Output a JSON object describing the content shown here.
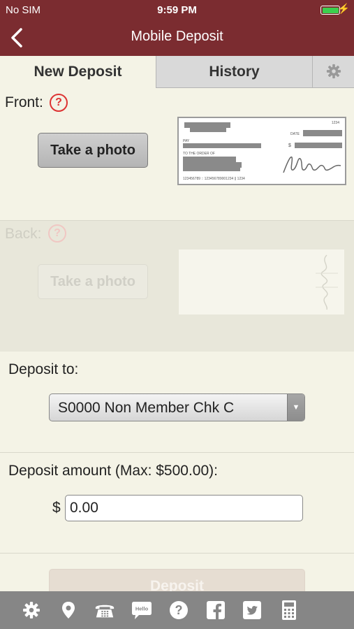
{
  "status_bar": {
    "carrier": "No SIM",
    "time": "9:59 PM"
  },
  "nav": {
    "title": "Mobile Deposit"
  },
  "tabs": {
    "new_deposit": "New Deposit",
    "history": "History"
  },
  "front": {
    "label": "Front:",
    "help": "?",
    "button": "Take a photo"
  },
  "back": {
    "label": "Back:",
    "help": "?",
    "button": "Take a photo"
  },
  "check_sample": {
    "number": "1234",
    "date_label": "DATE",
    "pay_label": "PAY",
    "order_label": "TO THE ORDER OF",
    "dollar_sign": "$",
    "micr": "123456789 :: 123456789001234 || 1234"
  },
  "deposit_to": {
    "label": "Deposit to:",
    "selected_account": "S0000 Non Member Chk C"
  },
  "amount": {
    "label": "Deposit amount (Max: $500.00):",
    "currency_symbol": "$",
    "value": "0.00"
  },
  "deposit_button": "Deposit",
  "toolbar": {
    "icons": [
      "gear-icon",
      "location-pin-icon",
      "phone-icon",
      "chat-hello-icon",
      "help-icon",
      "facebook-icon",
      "twitter-icon",
      "calculator-icon"
    ],
    "chat_text": "Hello"
  },
  "colors": {
    "header": "#7b2c30",
    "background": "#f4f3e6",
    "toolbar": "#868686",
    "help_red": "#dd3333"
  }
}
